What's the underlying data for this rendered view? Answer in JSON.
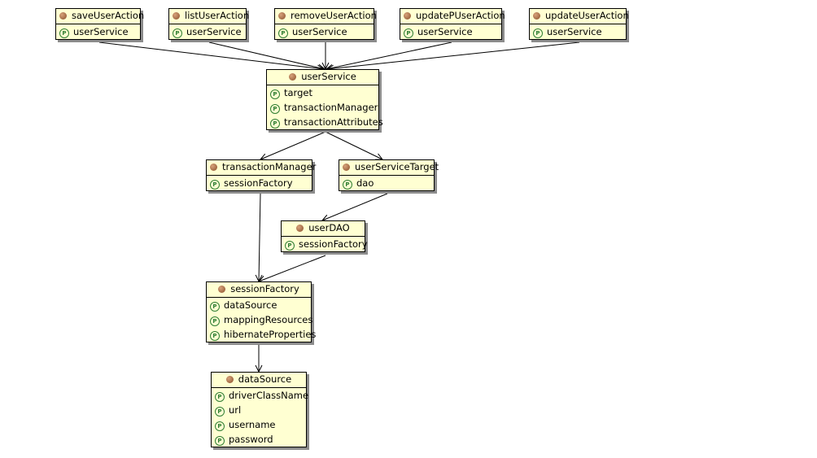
{
  "beans": [
    {
      "id": "saveUserAction",
      "name": "saveUserAction",
      "properties": [
        "userService"
      ]
    },
    {
      "id": "listUserAction",
      "name": "listUserAction",
      "properties": [
        "userService"
      ]
    },
    {
      "id": "removeUserAction",
      "name": "removeUserAction",
      "properties": [
        "userService"
      ]
    },
    {
      "id": "updatePUserAction",
      "name": "updatePUserAction",
      "properties": [
        "userService"
      ]
    },
    {
      "id": "updateUserAction",
      "name": "updateUserAction",
      "properties": [
        "userService"
      ]
    },
    {
      "id": "userService",
      "name": "userService",
      "properties": [
        "target",
        "transactionManager",
        "transactionAttributes"
      ]
    },
    {
      "id": "transactionManager",
      "name": "transactionManager",
      "properties": [
        "sessionFactory"
      ]
    },
    {
      "id": "userServiceTarget",
      "name": "userServiceTarget",
      "properties": [
        "dao"
      ]
    },
    {
      "id": "userDAO",
      "name": "userDAO",
      "properties": [
        "sessionFactory"
      ]
    },
    {
      "id": "sessionFactory",
      "name": "sessionFactory",
      "properties": [
        "dataSource",
        "mappingResources",
        "hibernateProperties"
      ]
    },
    {
      "id": "dataSource",
      "name": "dataSource",
      "properties": [
        "driverClassName",
        "url",
        "username",
        "password"
      ]
    }
  ],
  "edges": [
    [
      "saveUserAction",
      "userService"
    ],
    [
      "listUserAction",
      "userService"
    ],
    [
      "removeUserAction",
      "userService"
    ],
    [
      "updatePUserAction",
      "userService"
    ],
    [
      "updateUserAction",
      "userService"
    ],
    [
      "userService",
      "transactionManager"
    ],
    [
      "userService",
      "userServiceTarget"
    ],
    [
      "transactionManager",
      "sessionFactory"
    ],
    [
      "userServiceTarget",
      "userDAO"
    ],
    [
      "userDAO",
      "sessionFactory"
    ],
    [
      "sessionFactory",
      "dataSource"
    ]
  ],
  "icons": {
    "bean": "bean-icon",
    "property": "property-icon",
    "property_glyph": "P"
  },
  "colors": {
    "bean_fill": "#ffffd2",
    "property_icon": "#2e7d32"
  }
}
